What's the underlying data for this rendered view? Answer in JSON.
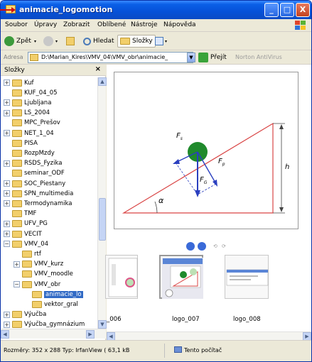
{
  "window": {
    "title": "animacie_logomotion",
    "minimize": "_",
    "maximize": "□",
    "close": "X"
  },
  "menu": [
    "Soubor",
    "Úpravy",
    "Zobrazit",
    "Oblíbené",
    "Nástroje",
    "Nápověda"
  ],
  "toolbar": {
    "back": "Zpět",
    "search": "Hledat",
    "folders": "Složky"
  },
  "address": {
    "label": "Adresa",
    "path": "D:\\Marian_Kires\\VMV_04\\VMV_obr\\animacie_",
    "go": "Přejít",
    "extra": "Norton AntiVirus"
  },
  "folders_pane": {
    "title": "Složky",
    "close": "×",
    "items": [
      {
        "label": "Kuf",
        "level": 1,
        "expander": "+"
      },
      {
        "label": "KUF_04_05",
        "level": 1,
        "expander": ""
      },
      {
        "label": "Ljubljana",
        "level": 1,
        "expander": "+"
      },
      {
        "label": "LS_2004",
        "level": 1,
        "expander": "+"
      },
      {
        "label": "MPC_Prešov",
        "level": 1,
        "expander": ""
      },
      {
        "label": "NET_1_04",
        "level": 1,
        "expander": "+"
      },
      {
        "label": "PISA",
        "level": 1,
        "expander": ""
      },
      {
        "label": "RozpMzdy",
        "level": 1,
        "expander": ""
      },
      {
        "label": "RSDS_Fyzika",
        "level": 1,
        "expander": "+"
      },
      {
        "label": "seminar_ODF",
        "level": 1,
        "expander": ""
      },
      {
        "label": "SOC_Piestany",
        "level": 1,
        "expander": "+"
      },
      {
        "label": "SPN_multimedia",
        "level": 1,
        "expander": "+"
      },
      {
        "label": "Termodynamika",
        "level": 1,
        "expander": "+"
      },
      {
        "label": "TMF",
        "level": 1,
        "expander": ""
      },
      {
        "label": "UFV_PG",
        "level": 1,
        "expander": "+"
      },
      {
        "label": "VECIT",
        "level": 1,
        "expander": "+"
      },
      {
        "label": "VMV_04",
        "level": 1,
        "expander": "−"
      },
      {
        "label": "rtf",
        "level": 2,
        "expander": ""
      },
      {
        "label": "VMV_kurz",
        "level": 2,
        "expander": "+"
      },
      {
        "label": "VMV_moodle",
        "level": 2,
        "expander": ""
      },
      {
        "label": "VMV_obr",
        "level": 2,
        "expander": "−"
      },
      {
        "label": "animacie_lo",
        "level": 3,
        "expander": "",
        "selected": true
      },
      {
        "label": "vektor_gral",
        "level": 3,
        "expander": ""
      },
      {
        "label": "Výučba",
        "level": 1,
        "expander": "+"
      },
      {
        "label": "Výučba_gymnázium",
        "level": 1,
        "expander": "+"
      }
    ]
  },
  "preview": {
    "labels": {
      "fs": "F",
      "fs_sub": "s",
      "fp": "F",
      "fp_sub": "p",
      "fg": "F",
      "fg_sub": "G",
      "alpha": "α",
      "h": "h"
    },
    "controls": [
      "⧏",
      "⧐",
      "⟲",
      "⟳"
    ]
  },
  "thumbnails": [
    {
      "label": "_006"
    },
    {
      "label": "logo_007"
    },
    {
      "label": "logo_008"
    }
  ],
  "status": {
    "info": "Rozměry: 352 x 288 Typ: IrfanView ( 63,1 kB",
    "location": "Tento počítač"
  }
}
